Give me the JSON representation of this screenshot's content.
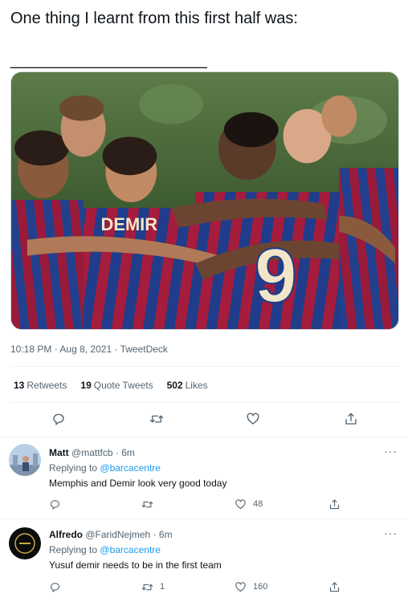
{
  "tweet": {
    "text": "One thing I learnt from this first half was:\n\n______________________",
    "time": "10:18 PM",
    "date": "Aug 8, 2021",
    "source": "TweetDeck",
    "sep": " · "
  },
  "stats": {
    "retweets_count": "13",
    "retweets_label": "Retweets",
    "quotes_count": "19",
    "quotes_label": "Quote Tweets",
    "likes_count": "502",
    "likes_label": "Likes"
  },
  "photo": {
    "jersey_text": "DEMIR",
    "number": "9"
  },
  "replies": [
    {
      "name": "Matt",
      "handle": "@mattfcb",
      "age": "· 6m",
      "replying_prefix": "Replying to",
      "replying_to": "@barcacentre",
      "text": "Memphis and Demir look very good today",
      "reply_count": "",
      "retweet_count": "",
      "like_count": "48"
    },
    {
      "name": "Alfredo",
      "handle": "@FaridNejmeh",
      "age": "· 6m",
      "replying_prefix": "Replying to",
      "replying_to": "@barcacentre",
      "text": "Yusuf demir needs to be in the first team",
      "reply_count": "",
      "retweet_count": "1",
      "like_count": "160"
    }
  ],
  "colors": {
    "accent": "#1d9bf0",
    "muted": "#536471",
    "text": "#0f1419",
    "divider": "#eff3f4"
  },
  "icons": [
    "reply-icon",
    "retweet-icon",
    "like-icon",
    "share-icon",
    "more-icon"
  ]
}
